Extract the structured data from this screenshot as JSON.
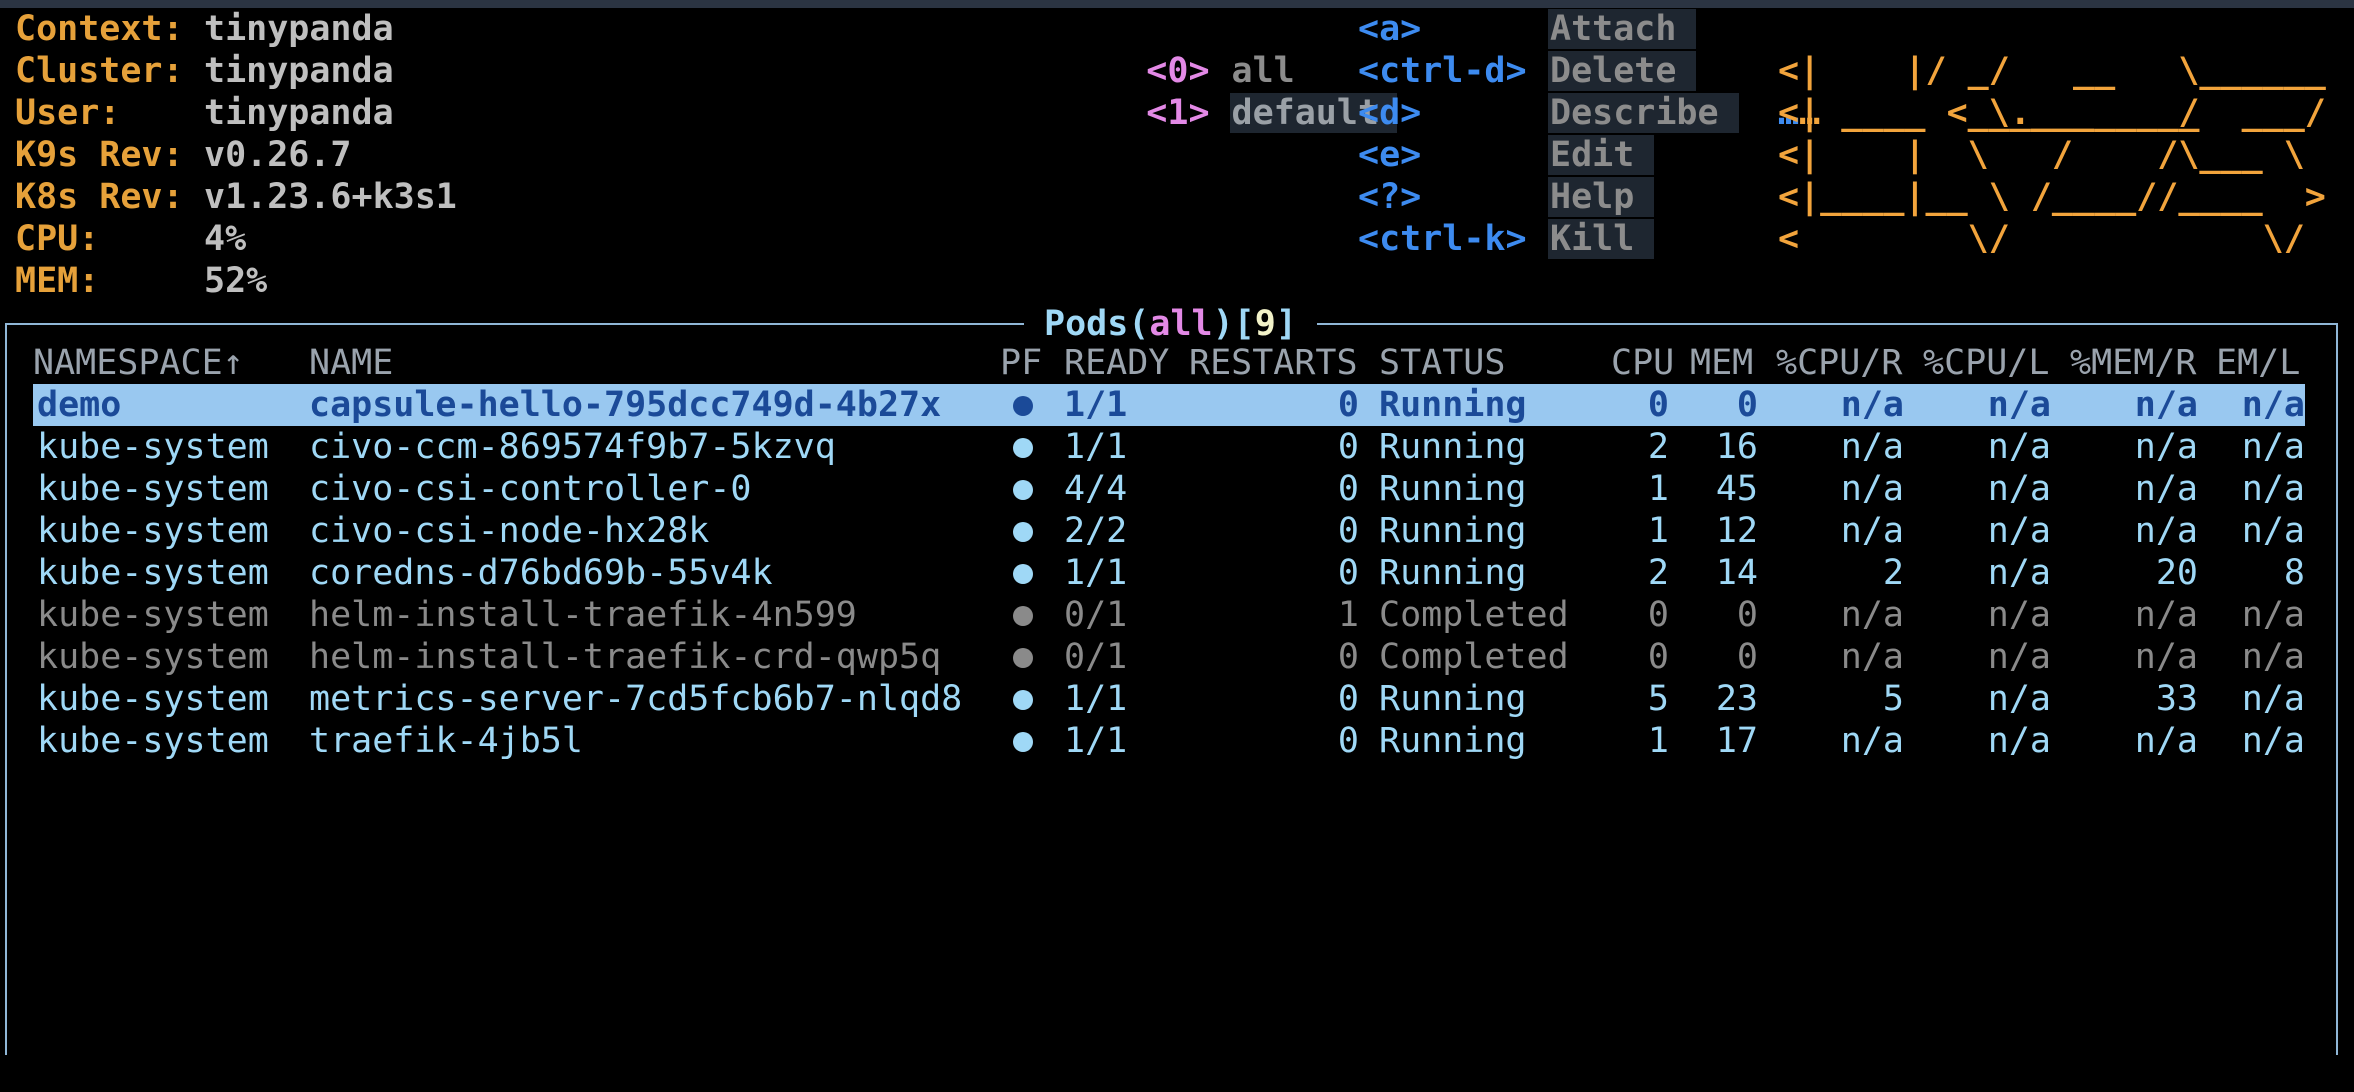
{
  "info": [
    {
      "key": "Context:",
      "value": "tinypanda"
    },
    {
      "key": "Cluster:",
      "value": "tinypanda"
    },
    {
      "key": "User:",
      "value": "tinypanda"
    },
    {
      "key": "K9s Rev:",
      "value": "v0.26.7"
    },
    {
      "key": "K8s Rev:",
      "value": "v1.23.6+k3s1"
    },
    {
      "key": "CPU:",
      "value": "4%"
    },
    {
      "key": "MEM:",
      "value": "52%"
    }
  ],
  "namespaces": [
    {
      "key": "<0>",
      "label": "all"
    },
    {
      "key": "<1>",
      "label": "default"
    }
  ],
  "hotkeys": [
    {
      "key": "<a>",
      "label": "Attach"
    },
    {
      "key": "<ctrl-d>",
      "label": "Delete"
    },
    {
      "key": "<d>",
      "label": "Describe"
    },
    {
      "key": "<e>",
      "label": "Edit"
    },
    {
      "key": "<?>",
      "label": "Help"
    },
    {
      "key": "<ctrl-k>",
      "label": "Kill"
    }
  ],
  "logo": [
    "… ____  __.________",
    "<|    |/ _/   __   \\______",
    "<|      < \\____    /  ___/",
    "<|    |  \\   /    /\\___ \\",
    "<|____|__ \\ /____//____  >",
    "<        \\/            \\/"
  ],
  "pods": {
    "title": "Pods",
    "namespace": "all",
    "count": "9",
    "columns": {
      "namespace": "NAMESPACE↑",
      "name": "NAME",
      "pf": "PF",
      "ready": "READY",
      "restarts": "RESTARTS",
      "status": "STATUS",
      "cpu": "CPU",
      "mem": "MEM",
      "cpu_r": "%CPU/R",
      "cpu_l": "%CPU/L",
      "mem_r": "%MEM/R",
      "mem_l": "EM/L"
    },
    "rows": [
      {
        "namespace": "demo",
        "name": "capsule-hello-795dcc749d-4b27x",
        "ready": "1/1",
        "restarts": "0",
        "status": "Running",
        "cpu": "0",
        "mem": "0",
        "cpu_r": "n/a",
        "cpu_l": "n/a",
        "mem_r": "n/a",
        "mem_l": "n/a",
        "state": "selected"
      },
      {
        "namespace": "kube-system",
        "name": "civo-ccm-869574f9b7-5kzvq",
        "ready": "1/1",
        "restarts": "0",
        "status": "Running",
        "cpu": "2",
        "mem": "16",
        "cpu_r": "n/a",
        "cpu_l": "n/a",
        "mem_r": "n/a",
        "mem_l": "n/a",
        "state": "running"
      },
      {
        "namespace": "kube-system",
        "name": "civo-csi-controller-0",
        "ready": "4/4",
        "restarts": "0",
        "status": "Running",
        "cpu": "1",
        "mem": "45",
        "cpu_r": "n/a",
        "cpu_l": "n/a",
        "mem_r": "n/a",
        "mem_l": "n/a",
        "state": "running"
      },
      {
        "namespace": "kube-system",
        "name": "civo-csi-node-hx28k",
        "ready": "2/2",
        "restarts": "0",
        "status": "Running",
        "cpu": "1",
        "mem": "12",
        "cpu_r": "n/a",
        "cpu_l": "n/a",
        "mem_r": "n/a",
        "mem_l": "n/a",
        "state": "running"
      },
      {
        "namespace": "kube-system",
        "name": "coredns-d76bd69b-55v4k",
        "ready": "1/1",
        "restarts": "0",
        "status": "Running",
        "cpu": "2",
        "mem": "14",
        "cpu_r": "2",
        "cpu_l": "n/a",
        "mem_r": "20",
        "mem_l": "8",
        "state": "running"
      },
      {
        "namespace": "kube-system",
        "name": "helm-install-traefik-4n599",
        "ready": "0/1",
        "restarts": "1",
        "status": "Completed",
        "cpu": "0",
        "mem": "0",
        "cpu_r": "n/a",
        "cpu_l": "n/a",
        "mem_r": "n/a",
        "mem_l": "n/a",
        "state": "completed"
      },
      {
        "namespace": "kube-system",
        "name": "helm-install-traefik-crd-qwp5q",
        "ready": "0/1",
        "restarts": "0",
        "status": "Completed",
        "cpu": "0",
        "mem": "0",
        "cpu_r": "n/a",
        "cpu_l": "n/a",
        "mem_r": "n/a",
        "mem_l": "n/a",
        "state": "completed"
      },
      {
        "namespace": "kube-system",
        "name": "metrics-server-7cd5fcb6b7-nlqd8",
        "ready": "1/1",
        "restarts": "0",
        "status": "Running",
        "cpu": "5",
        "mem": "23",
        "cpu_r": "5",
        "cpu_l": "n/a",
        "mem_r": "33",
        "mem_l": "n/a",
        "state": "running"
      },
      {
        "namespace": "kube-system",
        "name": "traefik-4jb5l",
        "ready": "1/1",
        "restarts": "0",
        "status": "Running",
        "cpu": "1",
        "mem": "17",
        "cpu_r": "n/a",
        "cpu_l": "n/a",
        "mem_r": "n/a",
        "mem_l": "n/a",
        "state": "running"
      }
    ]
  },
  "colors": {
    "accent_orange": "#e6a13a",
    "hotkey_blue": "#3d8bf0",
    "namespace_pink": "#e389e6",
    "row_text": "#9fd8f6",
    "selected_bg": "#99c8f0"
  }
}
